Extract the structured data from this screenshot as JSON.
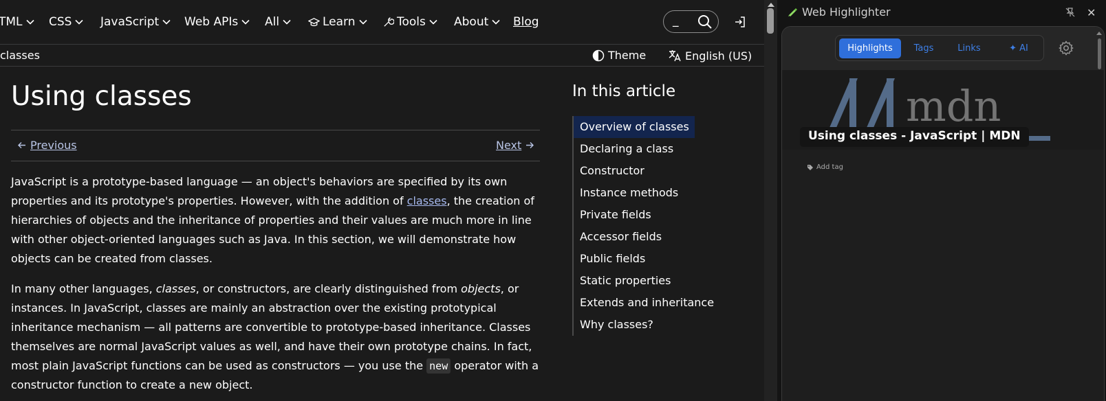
{
  "mdn": {
    "nav": {
      "items": [
        {
          "label": "TML"
        },
        {
          "label": "CSS"
        },
        {
          "label": "JavaScript"
        },
        {
          "label": "Web APIs"
        },
        {
          "label": "All"
        },
        {
          "label": "Learn"
        },
        {
          "label": "Tools"
        },
        {
          "label": "About"
        },
        {
          "label": "Blog"
        }
      ],
      "search_value": "_"
    },
    "breadcrumb": "classes",
    "theme_label": "Theme",
    "language_label": "English (US)",
    "title": "Using classes",
    "prev_label": "Previous",
    "next_label": "Next",
    "para1": {
      "a": "JavaScript is a prototype-based language — an object's behaviors are specified by its own properties and its prototype's properties. However, with the addition of ",
      "link": "classes",
      "b": ", the creation of hierarchies of objects and the inheritance of properties and their values are much more in line with other object-oriented languages such as Java. In this section, we will demonstrate how objects can be created from classes."
    },
    "para2": {
      "a": "In many other languages, ",
      "em1": "classes",
      "b": ", or constructors, are clearly distinguished from ",
      "em2": "objects",
      "c": ", or instances. In JavaScript, classes are mainly an abstraction over the existing prototypical inheritance mechanism — all patterns are convertible to prototype-based inheritance. Classes themselves are normal JavaScript values as well, and have their own prototype chains. In fact, most plain JavaScript functions can be used as constructors — you use the ",
      "code": "new",
      "d": " operator with a constructor function to create a new object."
    },
    "toc": {
      "title": "In this article",
      "items": [
        {
          "label": "Overview of classes"
        },
        {
          "label": "Declaring a class"
        },
        {
          "label": "Constructor"
        },
        {
          "label": "Instance methods"
        },
        {
          "label": "Private fields"
        },
        {
          "label": "Accessor fields"
        },
        {
          "label": "Public fields"
        },
        {
          "label": "Static properties"
        },
        {
          "label": "Extends and inheritance"
        },
        {
          "label": "Why classes?"
        }
      ]
    }
  },
  "highlighter": {
    "window_title": "Web Highlighter",
    "close_glyph": "✕",
    "tabs": [
      {
        "label": "Highlights"
      },
      {
        "label": "Tags"
      },
      {
        "label": "Links"
      },
      {
        "label": "✦ AI"
      }
    ],
    "logo_text": "mdn",
    "page_title": "Using classes - JavaScript | MDN",
    "add_tag_label": "Add tag"
  },
  "colors": {
    "accent": "#2f6fdb",
    "link": "#a6b9ee",
    "toc_active": "#13254e"
  }
}
